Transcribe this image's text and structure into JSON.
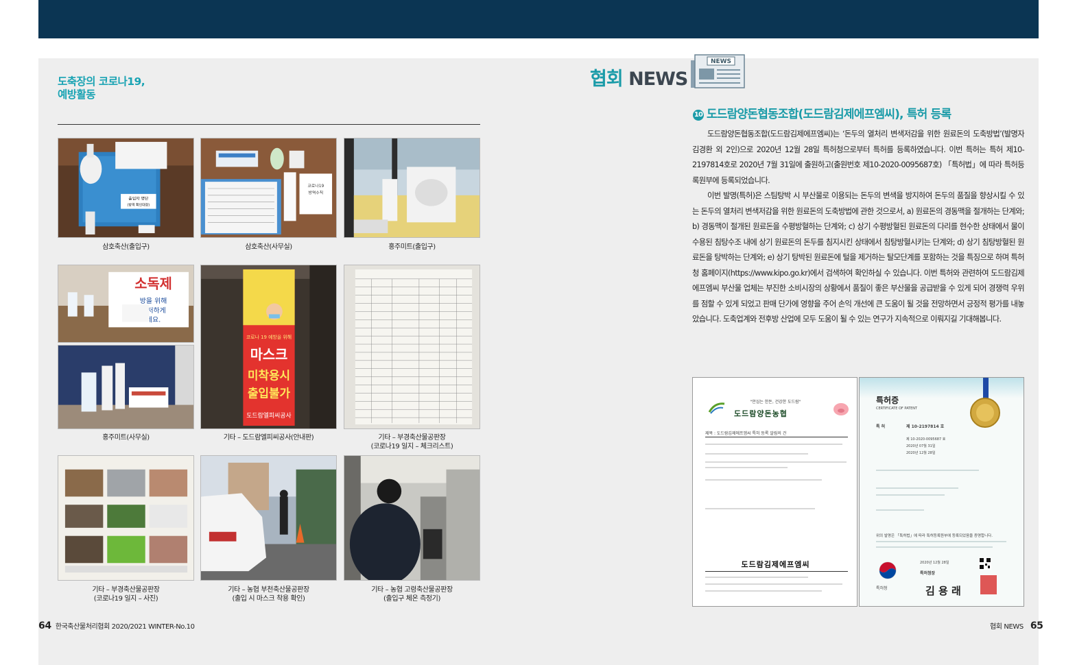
{
  "left_page": {
    "section_title_line1": "도축장의 코로나19,",
    "section_title_line2": "예방활동",
    "photos": [
      {
        "caption": "삼호축산(출입구)",
        "sign_lines": [
          "출입자 명단",
          "(방역 확인대장)"
        ]
      },
      {
        "caption": "삼호축산(사무실)",
        "sign_lines": [
          "코로나19",
          "방역수칙"
        ]
      },
      {
        "caption": "홍주미트(출입구)"
      },
      {
        "caption": "홍주미트(사무실)",
        "sign_lines": [
          "소독제",
          "방을 위해",
          "철저하게",
          "세요."
        ]
      },
      {
        "caption": "기타 – 도드람엘피씨공사(안내판)",
        "banner_lines": [
          "코로나 19 예방을 위해",
          "마스크",
          "미착용시",
          "출입불가",
          "도드람엘피씨공사"
        ]
      },
      {
        "caption_line1": "기타 – 부경축산물공판장",
        "caption_line2": "(코로나19 일지 – 체크리스트)"
      },
      {
        "caption_line1": "기타 – 부경축산물공판장",
        "caption_line2": "(코로나19 일지 – 사진)"
      },
      {
        "caption_line1": "기타 – 농협 부천축산물공판장",
        "caption_line2": "(출입 시 마스크 착용 확인)"
      },
      {
        "caption_line1": "기타 – 농협 고령축산물공판장",
        "caption_line2": "(출입구 체온 측정기)"
      }
    ],
    "footer": {
      "page": "64",
      "text": "한국축산물처리협회 2020/2021 WINTER-No.10"
    }
  },
  "right_page": {
    "brand_main": "협회",
    "brand_sub": "NEWS",
    "news_icon_label": "NEWS",
    "article": {
      "number": "10",
      "title": "도드람양돈협동조합(도드람김제에프엠씨), 특허 등록",
      "paragraph1": "도드람양돈협동조합(도드람김제에프엠씨)는 ‘돈두의 열처리 변색저감을 위한 원료돈의 도축방법’(발명자 김경환 외 2인)으로 2020년 12월 28일 특허청으로부터 특허를 등록하였습니다. 이번 특허는 특허 제10-2197814호로 2020년 7월 31일에 출원하고(출원번호 제10-2020-0095687호) 「특허법」에 따라 특허등록원부에 등록되었습니다.",
      "paragraph2": "이번 발명(특허)은 스팀탕박 시 부산물로 이용되는 돈두의 변색을 방지하여 돈두의 품질을 향상시킬 수 있는 돈두의 열처리 변색저감을 위한 원료돈의 도축방법에 관한 것으로서, a) 원료돈의 경동맥을 절개하는 단계와; b) 경동맥이 절개된 원료돈을 수평방혈하는 단계와; c) 상기 수평방혈된 원료돈의 다리를 현수한 상태에서 물이 수용된 침탕수조 내에 상기 원료돈의 돈두를 침지시킨 상태에서 침탕방혈시키는 단계와; d) 상기 침탕방혈된 원료돈을 탕박하는 단계와; e) 상기 탕박된 원료돈에 털을 제거하는 탈모단계를 포함하는 것을 특징으로 하며 특허청 홈페이지(https://www.kipo.go.kr)에서 검색하여 확인하실 수 있습니다. 이번 특허와 관련하여 도드람김제에프엠씨 부산물 업체는 부진한 소비시장의 상황에서 품질이 좋은 부산물을 공급받을 수 있게 되어 경쟁력 우위를 점할 수 있게 되었고 판매 단가에 영향을 주어 손익 개선에 큰 도움이 될 것을 전망하면서 긍정적 평가를 내놓았습니다. 도축업계와 전후방 산업에 모두 도움이 될 수 있는 연구가 지속적으로 이뤄지길 기대해봅니다."
    },
    "letter": {
      "slogan": "\"안심는 한돈, 건강한 도드람\"",
      "org": "도드람양돈농협",
      "subject": "제목 : 도드람김제에프엠씨 특허 등록 알림의 건",
      "signature": "도드람김제에프엠씨"
    },
    "certificate": {
      "title": "특허증",
      "subtitle": "CERTIFICATE OF PATENT",
      "patent_no_label": "특 허",
      "patent_no": "제 10-2197814 호",
      "app_no": "제 10-2020-0095687 호",
      "filing_date": "2020년 07월 31일",
      "reg_date": "2020년 12월 28일",
      "statement": "위의 발명은 「특허법」에 따라 특허등록원부에 등록되었음을 증명합니다.",
      "issue_date": "2020년 12월 28일",
      "issuer": "특허청장",
      "agency": "특허청",
      "signer": "김 용 래"
    },
    "footer": {
      "text": "협회 NEWS",
      "page": "65"
    }
  },
  "colors": {
    "header_band": "#0b3553",
    "accent_teal": "#1a9ba8",
    "page_bg": "#eeeeee"
  }
}
